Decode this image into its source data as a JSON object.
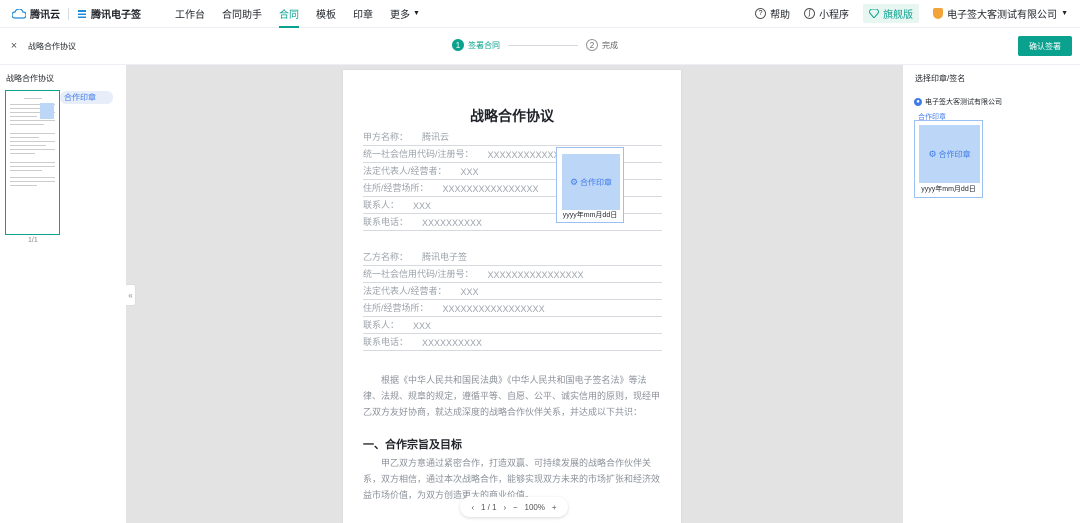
{
  "topnav": {
    "brand_name": "腾讯云",
    "product_name": "腾讯电子签",
    "menu": [
      "工作台",
      "合同助手",
      "合同",
      "模板",
      "印章",
      "更多"
    ],
    "active_index": 2,
    "help": "帮助",
    "mini_program": "小程序",
    "vip": "旗舰版",
    "company": "电子签大客测试有限公司"
  },
  "subheader": {
    "close_label": "×",
    "doc_title": "战略合作协议",
    "steps": [
      {
        "num": "1",
        "label": "签署合同"
      },
      {
        "num": "2",
        "label": "完成"
      }
    ],
    "confirm_button": "确认签署"
  },
  "left_panel": {
    "title": "战略合作协议",
    "page_indicator": "1/1",
    "sign_tag": "合作印章"
  },
  "collapse": "«",
  "document": {
    "title": "战略合作协议",
    "party_a": [
      {
        "label": "甲方名称：",
        "value": "腾讯云"
      },
      {
        "label": "统一社会信用代码/注册号：",
        "value": "XXXXXXXXXXXXXXXX"
      },
      {
        "label": "法定代表人/经营者：",
        "value": "XXX"
      },
      {
        "label": "住所/经营场所：",
        "value": "XXXXXXXXXXXXXXXX"
      },
      {
        "label": "联系人：",
        "value": "XXX"
      },
      {
        "label": "联系电话：",
        "value": "XXXXXXXXXX"
      }
    ],
    "party_b": [
      {
        "label": "乙方名称：",
        "value": "腾讯电子签"
      },
      {
        "label": "统一社会信用代码/注册号：",
        "value": "XXXXXXXXXXXXXXXX"
      },
      {
        "label": "法定代表人/经营者：",
        "value": "XXX"
      },
      {
        "label": "住所/经营场所：",
        "value": "XXXXXXXXXXXXXXXXX"
      },
      {
        "label": "联系人：",
        "value": "XXX"
      },
      {
        "label": "联系电话：",
        "value": "XXXXXXXXXX"
      }
    ],
    "preamble": "根据《中华人民共和国民法典》《中华人民共和国电子签名法》等法律、法规、规章的规定，遵循平等、自愿、公平、诚实信用的原则，现经甲乙双方友好协商，就达成深度的战略合作伙伴关系，并达成以下共识：",
    "section1_title": "一、合作宗旨及目标",
    "section1_text": "甲乙双方意通过紧密合作，打造双赢、可持续发展的战略合作伙伴关系，双方相信，通过本次战略合作，能够实现双方未来的市场扩张和经济效益市场价值，为双方创造更大的商业价值。",
    "seal_label": "合作印章",
    "seal_date": "yyyy年mm月dd日"
  },
  "pager": {
    "prev": "‹",
    "page": "1 / 1",
    "next": "›",
    "zoom_out": "−",
    "zoom": "100%",
    "zoom_in": "+"
  },
  "right_panel": {
    "title": "选择印章/签名",
    "company": "电子签大客测试有限公司",
    "seal_tab": "合作印章",
    "seal_label": "合作印章",
    "seal_date": "yyyy年mm月dd日"
  }
}
